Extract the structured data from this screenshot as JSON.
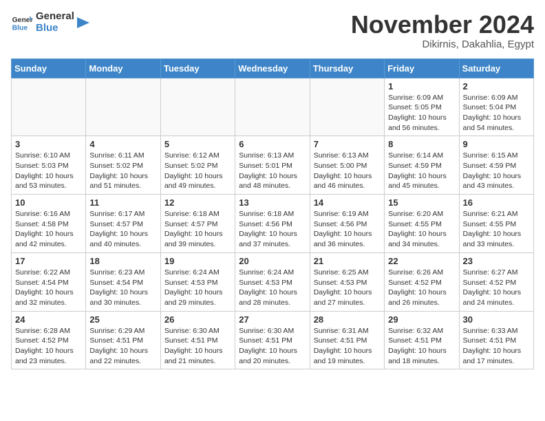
{
  "header": {
    "logo_general": "General",
    "logo_blue": "Blue",
    "month_title": "November 2024",
    "location": "Dikirnis, Dakahlia, Egypt"
  },
  "days_of_week": [
    "Sunday",
    "Monday",
    "Tuesday",
    "Wednesday",
    "Thursday",
    "Friday",
    "Saturday"
  ],
  "weeks": [
    [
      {
        "day": "",
        "info": ""
      },
      {
        "day": "",
        "info": ""
      },
      {
        "day": "",
        "info": ""
      },
      {
        "day": "",
        "info": ""
      },
      {
        "day": "",
        "info": ""
      },
      {
        "day": "1",
        "info": "Sunrise: 6:09 AM\nSunset: 5:05 PM\nDaylight: 10 hours\nand 56 minutes."
      },
      {
        "day": "2",
        "info": "Sunrise: 6:09 AM\nSunset: 5:04 PM\nDaylight: 10 hours\nand 54 minutes."
      }
    ],
    [
      {
        "day": "3",
        "info": "Sunrise: 6:10 AM\nSunset: 5:03 PM\nDaylight: 10 hours\nand 53 minutes."
      },
      {
        "day": "4",
        "info": "Sunrise: 6:11 AM\nSunset: 5:02 PM\nDaylight: 10 hours\nand 51 minutes."
      },
      {
        "day": "5",
        "info": "Sunrise: 6:12 AM\nSunset: 5:02 PM\nDaylight: 10 hours\nand 49 minutes."
      },
      {
        "day": "6",
        "info": "Sunrise: 6:13 AM\nSunset: 5:01 PM\nDaylight: 10 hours\nand 48 minutes."
      },
      {
        "day": "7",
        "info": "Sunrise: 6:13 AM\nSunset: 5:00 PM\nDaylight: 10 hours\nand 46 minutes."
      },
      {
        "day": "8",
        "info": "Sunrise: 6:14 AM\nSunset: 4:59 PM\nDaylight: 10 hours\nand 45 minutes."
      },
      {
        "day": "9",
        "info": "Sunrise: 6:15 AM\nSunset: 4:59 PM\nDaylight: 10 hours\nand 43 minutes."
      }
    ],
    [
      {
        "day": "10",
        "info": "Sunrise: 6:16 AM\nSunset: 4:58 PM\nDaylight: 10 hours\nand 42 minutes."
      },
      {
        "day": "11",
        "info": "Sunrise: 6:17 AM\nSunset: 4:57 PM\nDaylight: 10 hours\nand 40 minutes."
      },
      {
        "day": "12",
        "info": "Sunrise: 6:18 AM\nSunset: 4:57 PM\nDaylight: 10 hours\nand 39 minutes."
      },
      {
        "day": "13",
        "info": "Sunrise: 6:18 AM\nSunset: 4:56 PM\nDaylight: 10 hours\nand 37 minutes."
      },
      {
        "day": "14",
        "info": "Sunrise: 6:19 AM\nSunset: 4:56 PM\nDaylight: 10 hours\nand 36 minutes."
      },
      {
        "day": "15",
        "info": "Sunrise: 6:20 AM\nSunset: 4:55 PM\nDaylight: 10 hours\nand 34 minutes."
      },
      {
        "day": "16",
        "info": "Sunrise: 6:21 AM\nSunset: 4:55 PM\nDaylight: 10 hours\nand 33 minutes."
      }
    ],
    [
      {
        "day": "17",
        "info": "Sunrise: 6:22 AM\nSunset: 4:54 PM\nDaylight: 10 hours\nand 32 minutes."
      },
      {
        "day": "18",
        "info": "Sunrise: 6:23 AM\nSunset: 4:54 PM\nDaylight: 10 hours\nand 30 minutes."
      },
      {
        "day": "19",
        "info": "Sunrise: 6:24 AM\nSunset: 4:53 PM\nDaylight: 10 hours\nand 29 minutes."
      },
      {
        "day": "20",
        "info": "Sunrise: 6:24 AM\nSunset: 4:53 PM\nDaylight: 10 hours\nand 28 minutes."
      },
      {
        "day": "21",
        "info": "Sunrise: 6:25 AM\nSunset: 4:53 PM\nDaylight: 10 hours\nand 27 minutes."
      },
      {
        "day": "22",
        "info": "Sunrise: 6:26 AM\nSunset: 4:52 PM\nDaylight: 10 hours\nand 26 minutes."
      },
      {
        "day": "23",
        "info": "Sunrise: 6:27 AM\nSunset: 4:52 PM\nDaylight: 10 hours\nand 24 minutes."
      }
    ],
    [
      {
        "day": "24",
        "info": "Sunrise: 6:28 AM\nSunset: 4:52 PM\nDaylight: 10 hours\nand 23 minutes."
      },
      {
        "day": "25",
        "info": "Sunrise: 6:29 AM\nSunset: 4:51 PM\nDaylight: 10 hours\nand 22 minutes."
      },
      {
        "day": "26",
        "info": "Sunrise: 6:30 AM\nSunset: 4:51 PM\nDaylight: 10 hours\nand 21 minutes."
      },
      {
        "day": "27",
        "info": "Sunrise: 6:30 AM\nSunset: 4:51 PM\nDaylight: 10 hours\nand 20 minutes."
      },
      {
        "day": "28",
        "info": "Sunrise: 6:31 AM\nSunset: 4:51 PM\nDaylight: 10 hours\nand 19 minutes."
      },
      {
        "day": "29",
        "info": "Sunrise: 6:32 AM\nSunset: 4:51 PM\nDaylight: 10 hours\nand 18 minutes."
      },
      {
        "day": "30",
        "info": "Sunrise: 6:33 AM\nSunset: 4:51 PM\nDaylight: 10 hours\nand 17 minutes."
      }
    ]
  ]
}
